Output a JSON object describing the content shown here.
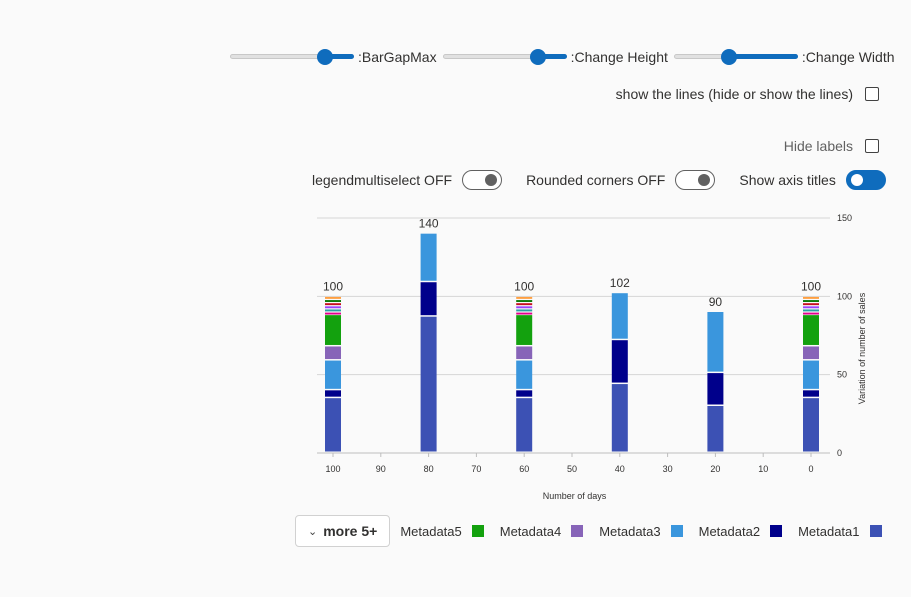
{
  "controls": {
    "sliders": [
      {
        "label": ":BarGapMax",
        "value": 0.78
      },
      {
        "label": ":Change Height",
        "value": 0.78
      },
      {
        "label": ":Change Width",
        "value": 0.42
      }
    ],
    "show_lines_label": "show the lines (hide or show the lines)",
    "hide_labels_label": "Hide labels",
    "toggles": [
      {
        "label": "legendmultiselect OFF",
        "on": false
      },
      {
        "label": "Rounded corners OFF",
        "on": false
      },
      {
        "label": "Show axis titles",
        "on": true
      }
    ]
  },
  "legend": {
    "more_label": "more 5+",
    "chevron": "chevron-down-icon",
    "items": [
      {
        "label": "Metadata5",
        "color": "#13a10e"
      },
      {
        "label": "Metadata4",
        "color": "#8764b8"
      },
      {
        "label": "Metadata3",
        "color": "#3a96dd"
      },
      {
        "label": "Metadata2",
        "color": "#00008b"
      },
      {
        "label": "Metadata1",
        "color": "#3c51b4"
      }
    ]
  },
  "chart_data": {
    "type": "bar",
    "stacked": true,
    "xlabel": "Number of days",
    "ylabel": "Variation of number of sales",
    "x_ticks": [
      100,
      90,
      80,
      70,
      60,
      50,
      40,
      30,
      20,
      10,
      0
    ],
    "xlim": [
      100,
      0
    ],
    "ylim": [
      0,
      150
    ],
    "y_ticks": [
      0,
      50,
      100,
      150
    ],
    "y_axis_position": "right",
    "grid": true,
    "bars": [
      {
        "x": 100,
        "total": 100,
        "segments": [
          {
            "series": "Metadata1",
            "value": 35
          },
          {
            "series": "Metadata2",
            "value": 5
          },
          {
            "series": "Metadata3",
            "value": 19
          },
          {
            "series": "Metadata4",
            "value": 9
          },
          {
            "series": "Metadata5",
            "value": 20
          },
          {
            "series": "other",
            "value": 12
          }
        ]
      },
      {
        "x": 80,
        "total": 140,
        "segments": [
          {
            "series": "Metadata1",
            "value": 87
          },
          {
            "series": "Metadata2",
            "value": 22
          },
          {
            "series": "Metadata3",
            "value": 31
          }
        ]
      },
      {
        "x": 60,
        "total": 100,
        "segments": [
          {
            "series": "Metadata1",
            "value": 35
          },
          {
            "series": "Metadata2",
            "value": 5
          },
          {
            "series": "Metadata3",
            "value": 19
          },
          {
            "series": "Metadata4",
            "value": 9
          },
          {
            "series": "Metadata5",
            "value": 20
          },
          {
            "series": "other",
            "value": 12
          }
        ]
      },
      {
        "x": 40,
        "total": 102,
        "segments": [
          {
            "series": "Metadata1",
            "value": 44
          },
          {
            "series": "Metadata2",
            "value": 28
          },
          {
            "series": "Metadata3",
            "value": 30
          }
        ]
      },
      {
        "x": 20,
        "total": 90,
        "segments": [
          {
            "series": "Metadata1",
            "value": 30
          },
          {
            "series": "Metadata2",
            "value": 21
          },
          {
            "series": "Metadata3",
            "value": 39
          }
        ]
      },
      {
        "x": 0,
        "total": 100,
        "segments": [
          {
            "series": "Metadata1",
            "value": 35
          },
          {
            "series": "Metadata2",
            "value": 5
          },
          {
            "series": "Metadata3",
            "value": 19
          },
          {
            "series": "Metadata4",
            "value": 9
          },
          {
            "series": "Metadata5",
            "value": 20
          },
          {
            "series": "other",
            "value": 12
          }
        ]
      }
    ],
    "series_colors": {
      "Metadata1": "#3c51b4",
      "Metadata2": "#00008b",
      "Metadata3": "#3a96dd",
      "Metadata4": "#8764b8",
      "Metadata5": "#13a10e"
    },
    "other_series_colors": [
      "#e3008c",
      "#2aa0a4",
      "#9a44fc",
      "#c50f1f",
      "#0e7a0b",
      "#ff9f40"
    ]
  }
}
